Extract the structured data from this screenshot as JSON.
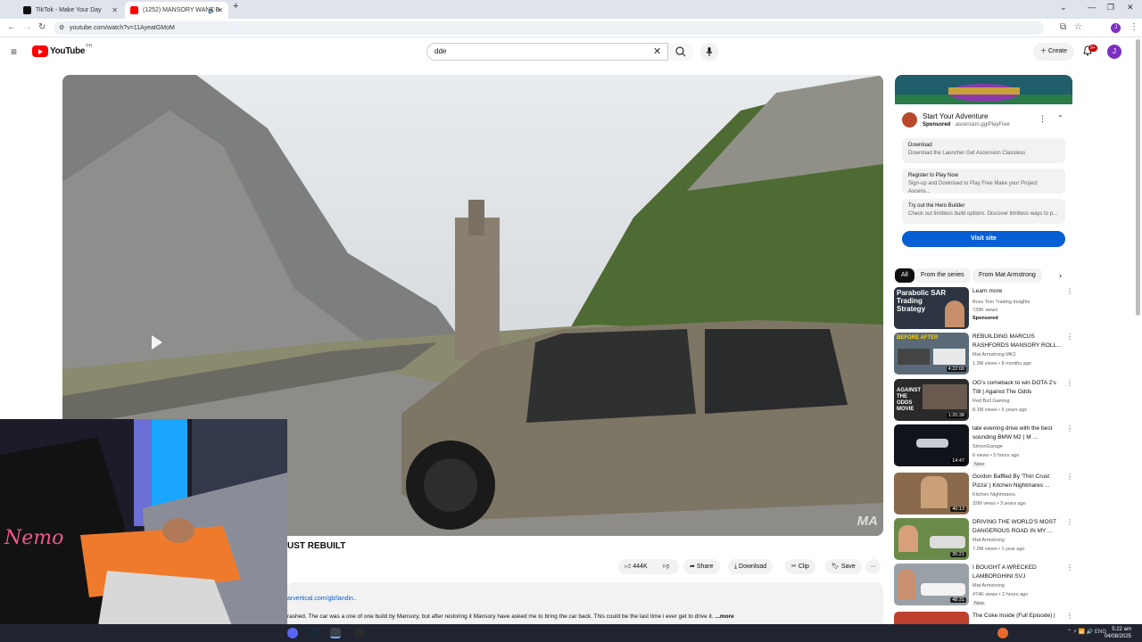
{
  "browser": {
    "tabs": [
      {
        "label": "TikTok - Make Your Day",
        "active": false
      },
      {
        "label": "(1252) MANSORY WANT B",
        "active": true
      }
    ],
    "url": "youtube.com/watch?v=11AyeatGMoM"
  },
  "youtube": {
    "logo_text": "YouTube",
    "region": "PH",
    "search_value": "dde",
    "create_label": "Create",
    "notif_count": "9+",
    "avatar_letter": "J"
  },
  "video": {
    "title": "UST REBUILT",
    "watermark": "MA",
    "likes": "444K",
    "share_label": "Share",
    "download_label": "Download",
    "clip_label": "Clip",
    "save_label": "Save",
    "desc_link": "arvertical.com/gb/landin..",
    "desc_text": "rashed. The car was a one of one build by Mansory, but after restoring it Mansory have asked me to bring the car back. This could be the last time i ever get to drive it.",
    "more_label": "...more"
  },
  "ad": {
    "title": "Start Your Adventure",
    "sponsored": "Sponsored",
    "domain": "ascension.gg/PlayFree",
    "options": [
      {
        "title": "Download",
        "sub": "Download the Launcher Get Ascension Classless"
      },
      {
        "title": "Register to Play Now",
        "sub": "Sign-up and Download to Play Free Make your Project Ascens..."
      },
      {
        "title": "Try out the Hero Builder",
        "sub": "Check out limitless build options. Discover limitless ways to p..."
      }
    ],
    "visit_label": "Visit site"
  },
  "chips": [
    "All",
    "From the series",
    "From Mat Armstrong"
  ],
  "recs": [
    {
      "title": "Learn more",
      "channel": "Boss Tom Trading Insights",
      "meta": "739K views",
      "tag": "Sponsored",
      "duration": "",
      "thumb_color": "#2b3440",
      "thumb_text": "Parabolic SAR Trading Strategy"
    },
    {
      "title": "REBUILDING MARCUS RASHFORDS MANSORY ROLL...",
      "channel": "Mat Armstrong MK2",
      "meta": "1.3M views • 8 months ago",
      "tag": "",
      "duration": "4:22:00",
      "thumb_color": "#5a6a78",
      "thumb_text": "BEFORE AFTER"
    },
    {
      "title": "OG's comeback to win DOTA 2's TI8 | Against The Odds",
      "channel": "Red Bull Gaming",
      "meta": "8.1M views • 5 years ago",
      "tag": "",
      "duration": "1:20:38",
      "thumb_color": "#2a2a2a",
      "thumb_text": "AGAINST THE ODDS MOVIE"
    },
    {
      "title": "late evening drive with the best sounding BMW M2 | M ...",
      "channel": "SimonGarage",
      "meta": "6 views • 5 hours ago",
      "tag": "New",
      "duration": "14:47",
      "thumb_color": "#10131a",
      "thumb_text": ""
    },
    {
      "title": "Gordon Baffled By 'Thin Crust Pizza' | Kitchen Nightmares ...",
      "channel": "Kitchen Nightmares",
      "meta": "32M views • 3 years ago",
      "tag": "",
      "duration": "40:13",
      "thumb_color": "#8a6a4a",
      "thumb_text": ""
    },
    {
      "title": "DRIVING THE WORLD'S MOST DANGEROUS ROAD IN MY ...",
      "channel": "Mat Armstrong",
      "meta": "7.2M views • 1 year ago",
      "tag": "",
      "duration": "35:21",
      "thumb_color": "#6a8a4a",
      "thumb_text": ""
    },
    {
      "title": "I BOUGHT A WRECKED LAMBORGHINI SVJ",
      "channel": "Mat Armstrong",
      "meta": "474K views • 2 hours ago",
      "tag": "New",
      "duration": "48:31",
      "thumb_color": "#9aa0a8",
      "thumb_text": ""
    },
    {
      "title": "The Coke Inside (Full Episode) |",
      "channel": "",
      "meta": "",
      "tag": "",
      "duration": "",
      "thumb_color": "#c04030",
      "thumb_text": ""
    }
  ],
  "taskbar": {
    "lang": "ENG",
    "time": "5:22 am",
    "date": "04/08/2025"
  }
}
